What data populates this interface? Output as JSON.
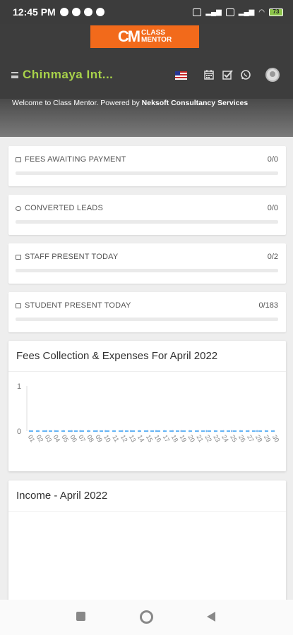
{
  "status": {
    "time": "12:45 PM",
    "battery": "73"
  },
  "header": {
    "logo_mark": "CM",
    "logo_line1": "CLASS",
    "logo_line2": "MENTOR",
    "school_name": "Chinmaya Int..."
  },
  "welcome": {
    "prefix": "Welcome to Class Mentor. Powered by ",
    "company": "Neksoft Consultancy Services"
  },
  "stats": [
    {
      "label": "FEES AWAITING PAYMENT",
      "count": "0/0",
      "icon": "money-icon",
      "fraction": 0
    },
    {
      "label": "CONVERTED LEADS",
      "count": "0/0",
      "icon": "users-icon",
      "fraction": 0
    },
    {
      "label": "STAFF PRESENT TODAY",
      "count": "0/2",
      "icon": "calendar-icon",
      "fraction": 0
    },
    {
      "label": "STUDENT PRESENT TODAY",
      "count": "0/183",
      "icon": "calendar-icon",
      "fraction": 0
    }
  ],
  "fees_panel": {
    "title": "Fees Collection & Expenses For April 2022"
  },
  "income_panel": {
    "title": "Income - April 2022"
  },
  "chart_data": {
    "type": "line",
    "title": "Fees Collection & Expenses For April 2022",
    "xlabel": "",
    "ylabel": "",
    "ylim": [
      0,
      1
    ],
    "y_ticks": [
      "0",
      "1"
    ],
    "x": [
      "01",
      "02",
      "03",
      "04",
      "05",
      "06",
      "07",
      "08",
      "09",
      "10",
      "11",
      "12",
      "13",
      "14",
      "15",
      "16",
      "17",
      "18",
      "19",
      "20",
      "21",
      "22",
      "23",
      "24",
      "25",
      "26",
      "27",
      "28",
      "29",
      "30"
    ],
    "series": [
      {
        "values": [
          0,
          0,
          0,
          0,
          0,
          0,
          0,
          0,
          0,
          0,
          0,
          0,
          0,
          0,
          0,
          0,
          0,
          0,
          0,
          0,
          0,
          0,
          0,
          0,
          0,
          0,
          0,
          0,
          0,
          0
        ],
        "color": "#e57373"
      },
      {
        "values": [
          0,
          0,
          0,
          0,
          0,
          0,
          0,
          0,
          0,
          0,
          0,
          0,
          0,
          0,
          0,
          0,
          0,
          0,
          0,
          0,
          0,
          0,
          0,
          0,
          0,
          0,
          0,
          0,
          0,
          0
        ],
        "color": "#64b5f6"
      }
    ],
    "grid": false,
    "legend": "none"
  },
  "colors": {
    "accent": "#f26a1b",
    "school_name": "#a8d24a",
    "header_bg": "#3d3d3d"
  }
}
